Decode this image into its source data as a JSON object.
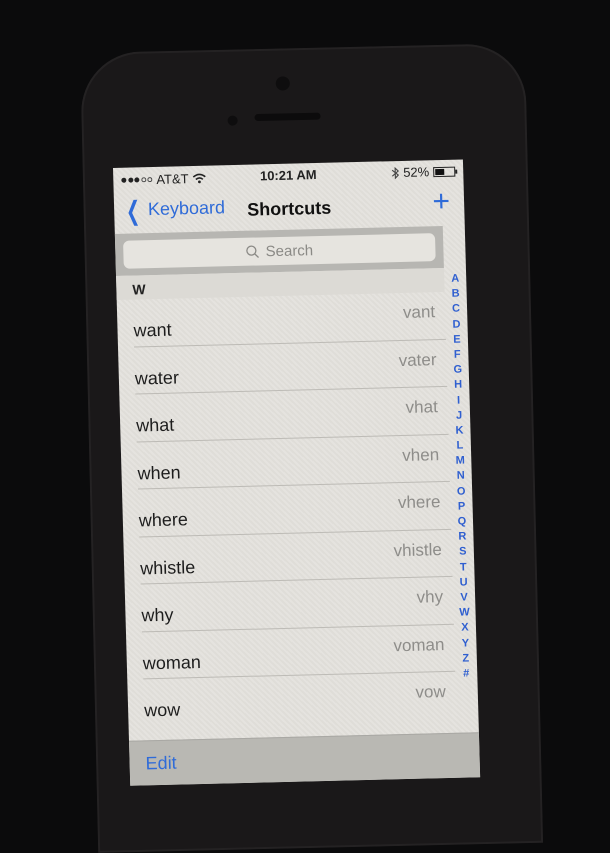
{
  "status_bar": {
    "signal_bars_filled": 3,
    "signal_bars_total": 5,
    "carrier": "AT&T",
    "wifi_icon": "wifi-icon",
    "time": "10:21 AM",
    "bluetooth_icon": "bluetooth-icon",
    "battery_percent_label": "52%",
    "battery_level": 0.52
  },
  "nav": {
    "back_label": "Keyboard",
    "title": "Shortcuts",
    "add_label": "+"
  },
  "search": {
    "placeholder": "Search"
  },
  "section_header": "W",
  "shortcuts": [
    {
      "phrase": "want",
      "shortcut": "vant"
    },
    {
      "phrase": "water",
      "shortcut": "vater"
    },
    {
      "phrase": "what",
      "shortcut": "vhat"
    },
    {
      "phrase": "when",
      "shortcut": "vhen"
    },
    {
      "phrase": "where",
      "shortcut": "vhere"
    },
    {
      "phrase": "whistle",
      "shortcut": "vhistle"
    },
    {
      "phrase": "why",
      "shortcut": "vhy"
    },
    {
      "phrase": "woman",
      "shortcut": "voman"
    },
    {
      "phrase": "wow",
      "shortcut": "vow"
    }
  ],
  "index_letters": [
    "A",
    "B",
    "C",
    "D",
    "E",
    "F",
    "G",
    "H",
    "I",
    "J",
    "K",
    "L",
    "M",
    "N",
    "O",
    "P",
    "Q",
    "R",
    "S",
    "T",
    "U",
    "V",
    "W",
    "X",
    "Y",
    "Z",
    "#"
  ],
  "toolbar": {
    "edit_label": "Edit"
  },
  "colors": {
    "accent": "#2f6bd8",
    "index": "#2f5fd0"
  }
}
